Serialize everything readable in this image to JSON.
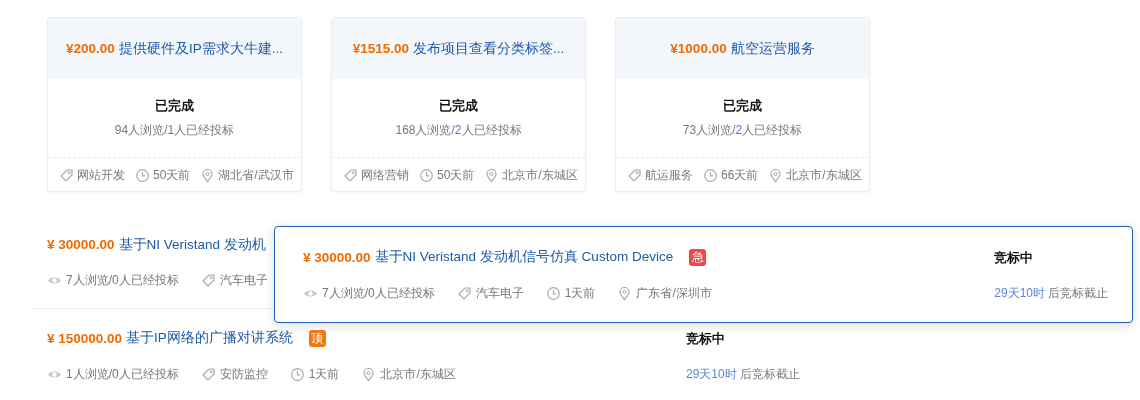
{
  "cards": [
    {
      "price": "¥200.00",
      "title": "提供硬件及IP需求大牛建...",
      "status": "已完成",
      "stats": {
        "views": "94人浏览/",
        "bids": "1",
        "bids_suffix": "人已经投标"
      },
      "meta": [
        {
          "kind": "tag",
          "text": "网站开发"
        },
        {
          "kind": "time",
          "text": "50天前"
        },
        {
          "kind": "location",
          "text": "湖北省/武汉市"
        }
      ]
    },
    {
      "price": "¥1515.00",
      "title": "发布项目查看分类标签...",
      "status": "已完成",
      "stats": {
        "views": "168人浏览/",
        "bids": "2",
        "bids_suffix": "人已经投标"
      },
      "meta": [
        {
          "kind": "tag",
          "text": "网络营销"
        },
        {
          "kind": "time",
          "text": "50天前"
        },
        {
          "kind": "location",
          "text": "北京市/东城区"
        }
      ]
    },
    {
      "price": "¥1000.00",
      "title": "航空运营服务",
      "status": "已完成",
      "stats": {
        "views": "73人浏览/",
        "bids": "2",
        "bids_suffix": "人已经投标"
      },
      "meta": [
        {
          "kind": "tag",
          "text": "航运服务"
        },
        {
          "kind": "time",
          "text": "66天前"
        },
        {
          "kind": "location",
          "text": "北京市/东城区"
        }
      ]
    }
  ],
  "rows": [
    {
      "price": "¥ 30000.00",
      "title": "基于NI Veristand 发动机",
      "meta": [
        {
          "kind": "views",
          "text": "7人浏览/0人已经投标"
        },
        {
          "kind": "tag",
          "text": "汽车电子"
        }
      ]
    },
    {
      "price": "¥ 150000.00",
      "title": "基于IP网络的广播对讲系统",
      "badge": {
        "kind": "top",
        "text": "顶"
      },
      "status": "竞标中",
      "deadline": {
        "remaining": "29天10时",
        "suffix": "后竞标截止"
      },
      "meta": [
        {
          "kind": "views",
          "text": "1人浏览/0人已经投标"
        },
        {
          "kind": "tag",
          "text": "安防监控"
        },
        {
          "kind": "time",
          "text": "1天前"
        },
        {
          "kind": "location",
          "text": "北京市/东城区"
        }
      ]
    }
  ],
  "hover_card": {
    "price": "¥ 30000.00",
    "title": "基于NI Veristand 发动机信号仿真 Custom Device",
    "badge": {
      "kind": "urgent",
      "text": "急"
    },
    "status": "竞标中",
    "deadline": {
      "remaining": "29天10时",
      "suffix": "后竞标截止"
    },
    "meta": [
      {
        "kind": "views",
        "text": "7人浏览/0人已经投标"
      },
      {
        "kind": "tag",
        "text": "汽车电子"
      },
      {
        "kind": "time",
        "text": "1天前"
      },
      {
        "kind": "location",
        "text": "广东省/深圳市"
      }
    ]
  }
}
